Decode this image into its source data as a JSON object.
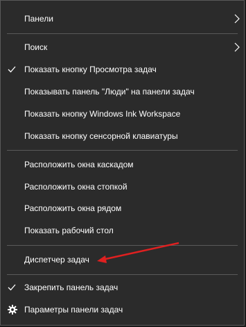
{
  "menu": {
    "items": [
      {
        "label": "Панели",
        "icon": "",
        "submenu": true
      },
      {
        "label": "Поиск",
        "icon": "",
        "submenu": true
      },
      {
        "label": "Показать кнопку Просмотра задач",
        "icon": "check-icon",
        "submenu": false
      },
      {
        "label": "Показывать панель \"Люди\" на панели задач",
        "icon": "",
        "submenu": false
      },
      {
        "label": "Показать кнопку Windows Ink Workspace",
        "icon": "",
        "submenu": false
      },
      {
        "label": "Показать кнопку сенсорной клавиатуры",
        "icon": "",
        "submenu": false
      },
      {
        "label": "Расположить окна каскадом",
        "icon": "",
        "submenu": false
      },
      {
        "label": "Расположить окна стопкой",
        "icon": "",
        "submenu": false
      },
      {
        "label": "Расположить окна рядом",
        "icon": "",
        "submenu": false
      },
      {
        "label": "Показать рабочий стол",
        "icon": "",
        "submenu": false
      },
      {
        "label": "Диспетчер задач",
        "icon": "",
        "submenu": false
      },
      {
        "label": "Закрепить панель задач",
        "icon": "check-icon",
        "submenu": false
      },
      {
        "label": "Параметры панели задач",
        "icon": "gear-icon",
        "submenu": false
      }
    ]
  },
  "colors": {
    "background": "#2b2b2b",
    "text": "#ffffff",
    "separator": "#5a5a5a",
    "arrow": "#e02020"
  }
}
